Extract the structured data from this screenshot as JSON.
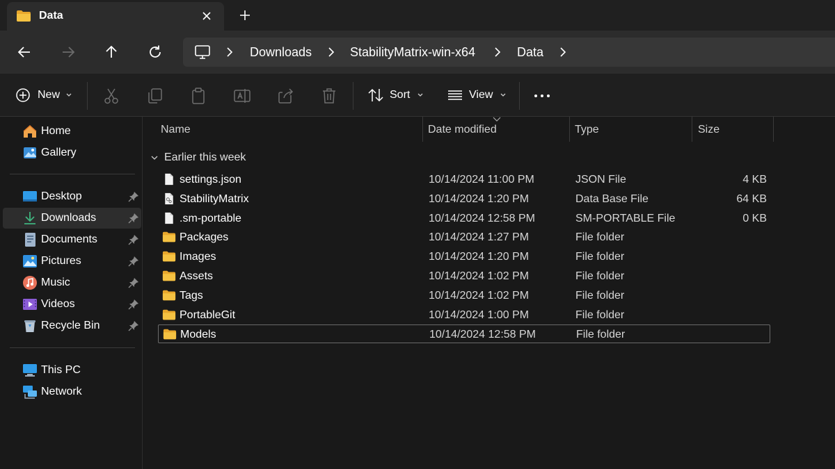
{
  "tab": {
    "title": "Data",
    "close_icon": "close-icon",
    "new_tab_icon": "plus-icon"
  },
  "nav": {
    "breadcrumb": [
      "Downloads",
      "StabilityMatrix-win-x64",
      "Data"
    ]
  },
  "commands": {
    "new_label": "New",
    "sort_label": "Sort",
    "view_label": "View"
  },
  "sidebar": {
    "top": [
      {
        "label": "Home",
        "icon": "home-icon"
      },
      {
        "label": "Gallery",
        "icon": "gallery-icon"
      }
    ],
    "quick": [
      {
        "label": "Desktop",
        "icon": "desktop-icon"
      },
      {
        "label": "Downloads",
        "icon": "download-icon",
        "active": true
      },
      {
        "label": "Documents",
        "icon": "documents-icon"
      },
      {
        "label": "Pictures",
        "icon": "pictures-icon"
      },
      {
        "label": "Music",
        "icon": "music-icon"
      },
      {
        "label": "Videos",
        "icon": "videos-icon"
      },
      {
        "label": "Recycle Bin",
        "icon": "recycle-bin-icon"
      }
    ],
    "bottom": [
      {
        "label": "This PC",
        "icon": "computer-icon"
      },
      {
        "label": "Network",
        "icon": "network-icon"
      }
    ]
  },
  "list": {
    "columns": [
      "Name",
      "Date modified",
      "Type",
      "Size"
    ],
    "group_label": "Earlier this week",
    "rows": [
      {
        "name": "settings.json",
        "date": "10/14/2024 11:00 PM",
        "type": "JSON File",
        "size": "4 KB",
        "icon": "file-icon"
      },
      {
        "name": "StabilityMatrix",
        "date": "10/14/2024 1:20 PM",
        "type": "Data Base File",
        "size": "64 KB",
        "icon": "database-file-icon"
      },
      {
        "name": ".sm-portable",
        "date": "10/14/2024 12:58 PM",
        "type": "SM-PORTABLE File",
        "size": "0 KB",
        "icon": "file-icon"
      },
      {
        "name": "Packages",
        "date": "10/14/2024 1:27 PM",
        "type": "File folder",
        "size": "",
        "icon": "folder-icon"
      },
      {
        "name": "Images",
        "date": "10/14/2024 1:20 PM",
        "type": "File folder",
        "size": "",
        "icon": "folder-icon"
      },
      {
        "name": "Assets",
        "date": "10/14/2024 1:02 PM",
        "type": "File folder",
        "size": "",
        "icon": "folder-icon"
      },
      {
        "name": "Tags",
        "date": "10/14/2024 1:02 PM",
        "type": "File folder",
        "size": "",
        "icon": "folder-icon"
      },
      {
        "name": "PortableGit",
        "date": "10/14/2024 1:00 PM",
        "type": "File folder",
        "size": "",
        "icon": "folder-icon"
      },
      {
        "name": "Models",
        "date": "10/14/2024 12:58 PM",
        "type": "File folder",
        "size": "",
        "icon": "folder-icon",
        "selected": true
      }
    ]
  },
  "colors": {
    "folder": "#f5c242",
    "accent": "#4cc2ff",
    "download": "#3fb37f"
  }
}
